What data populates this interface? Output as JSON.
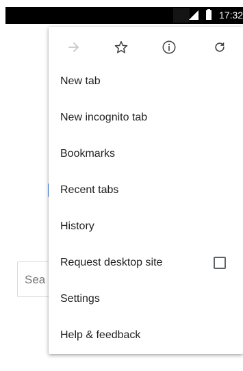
{
  "status_bar": {
    "time": "17:32",
    "signal_icon": "signal-icon",
    "battery_icon": "battery-icon"
  },
  "background_page": {
    "search_placeholder": "Sea"
  },
  "menu": {
    "toolbar": [
      {
        "name": "forward",
        "icon": "arrow-forward-icon",
        "enabled": false
      },
      {
        "name": "bookmark",
        "icon": "star-outline-icon",
        "enabled": true
      },
      {
        "name": "page-info",
        "icon": "info-icon",
        "enabled": true
      },
      {
        "name": "reload",
        "icon": "reload-icon",
        "enabled": true
      }
    ],
    "items": [
      {
        "label": "New tab"
      },
      {
        "label": "New incognito tab"
      },
      {
        "label": "Bookmarks"
      },
      {
        "label": "Recent tabs"
      },
      {
        "label": "History"
      },
      {
        "label": "Request desktop site",
        "checkbox": true,
        "checked": false
      },
      {
        "label": "Settings"
      },
      {
        "label": "Help & feedback"
      }
    ]
  },
  "colors": {
    "status_bar_bg": "#000000",
    "menu_text": "#212121",
    "icon_active": "#5f6368",
    "icon_disabled": "#c7c7c7",
    "accent": "#4285f4"
  }
}
